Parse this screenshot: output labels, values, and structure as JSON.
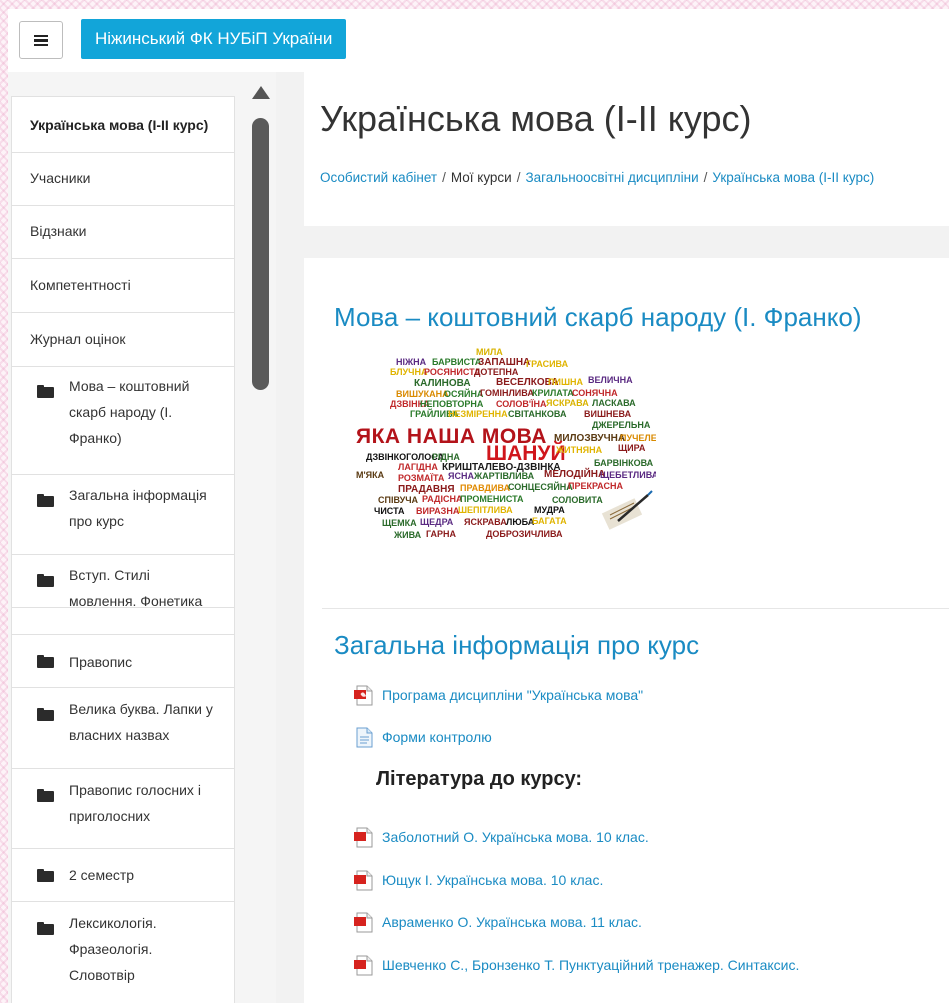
{
  "navbar": {
    "brand": "Ніжинський ФК НУБіП України"
  },
  "sidebar": {
    "items": [
      {
        "label": "Українська мова (I-II курс)",
        "active": true
      },
      {
        "label": "Учасники"
      },
      {
        "label": "Відзнаки"
      },
      {
        "label": "Компетентності"
      },
      {
        "label": "Журнал оцінок"
      }
    ],
    "sections": [
      {
        "label": "Мова – коштовний скарб народу (І. Франко)"
      },
      {
        "label": "Загальна інформація про курс"
      },
      {
        "label": "Вступ. Стилі мовлення. Фонетика"
      },
      {
        "label": "Правопис"
      },
      {
        "label": "Велика буква. Лапки у власних назвах"
      },
      {
        "label": "Правопис голосних і приголосних"
      },
      {
        "label": "2 семестр"
      },
      {
        "label": "Лексикологія. Фразеологія. Словотвір"
      }
    ]
  },
  "header": {
    "title": "Українська мова (I-II курс)",
    "breadcrumb": [
      "Особистий кабінет",
      "Мої курси",
      "Загальноосвітні дисципліни",
      "Українська мова (I-II курс)"
    ]
  },
  "content": {
    "section1_title": "Мова – коштовний скарб народу (І. Франко)",
    "wordcloud": {
      "main": "ЯКА НАША МОВА",
      "shanui": "ШАНУЙ",
      "words": [
        "МИЛА",
        "НІЖНА",
        "БАРВИСТА",
        "ЗАПАШНА",
        "БЛУЧНА",
        "РОСЯНИСТА",
        "ДОТЕПНА",
        "ГРАСИВА",
        "КАЛИНОВА",
        "ВЕСЕЛКОВА",
        "ПИШНА",
        "ВЕЛИЧНА",
        "ВИШУКАНА",
        "ОСЯЙНА",
        "ГОМІНЛИВА",
        "КРИЛАТА",
        "СОНЯЧНА",
        "ДЗВІНКА",
        "НЕПОВТОРНА",
        "СОЛОВ'ЇНА",
        "ЯСКРАВА",
        "ЛАСКАВА",
        "ГРАЙЛИВА",
        "НЕЗМІРЕННА",
        "СВІТАНКОВА",
        "ВИШНЕВА",
        "ДЖЕРЕЛЬНА",
        "МИЛОЗВУЧНА",
        "ПУЧЕЛЕ",
        "ЩИРА",
        "ДЗВІНКОГОЛОСА",
        "РІДНА",
        "ЖИТНЯНА",
        "ЛАГІДНА",
        "КРИШТАЛЕВО-ДЗВІНКА",
        "БАРВІНКОВА",
        "М'ЯКА",
        "РОЗМАЇТА",
        "ЯСНА",
        "ЖАРТІВЛИВА",
        "МЕЛОДІЙНА",
        "ЩЕБЕТЛИВА",
        "ПРАДАВНЯ",
        "ПРАВДИВА",
        "СОНЦЕСЯЙНА",
        "ПРЕКРАСНА",
        "СПІВУЧА",
        "РАДІСНА",
        "ПРОМЕНИСТА",
        "СОЛОВИТА",
        "ЧИСТА",
        "ВИРАЗНА",
        "ШЕПІТЛИВА",
        "МУДРА",
        "ЩЕМКА",
        "ЩЕДРА",
        "ЯСКРАВА",
        "ЛЮБА",
        "БАГАТА",
        "ЖИВА",
        "ГАРНА",
        "ДОБРОЗИЧЛИВА"
      ]
    },
    "section2_title": "Загальна інформація про курс",
    "activities": [
      {
        "label": "Програма дисципліни \"Українська мова\"",
        "icon": "pdf"
      },
      {
        "label": "Форми контролю",
        "icon": "document"
      }
    ],
    "literature_heading": "Література до курсу:",
    "literature": [
      {
        "label": "Заболотний О. Українська мова. 10 клас."
      },
      {
        "label": "Ющук І. Українська мова. 10 клас."
      },
      {
        "label": "Авраменко О. Українська мова. 11 клас."
      },
      {
        "label": "Шевченко С., Бронзенко Т. Пунктуаційний тренажер. Синтаксис."
      }
    ]
  },
  "colors": {
    "brand_bg": "#12a5d9",
    "link": "#1a8bc3",
    "pdf_red": "#d6231e"
  }
}
